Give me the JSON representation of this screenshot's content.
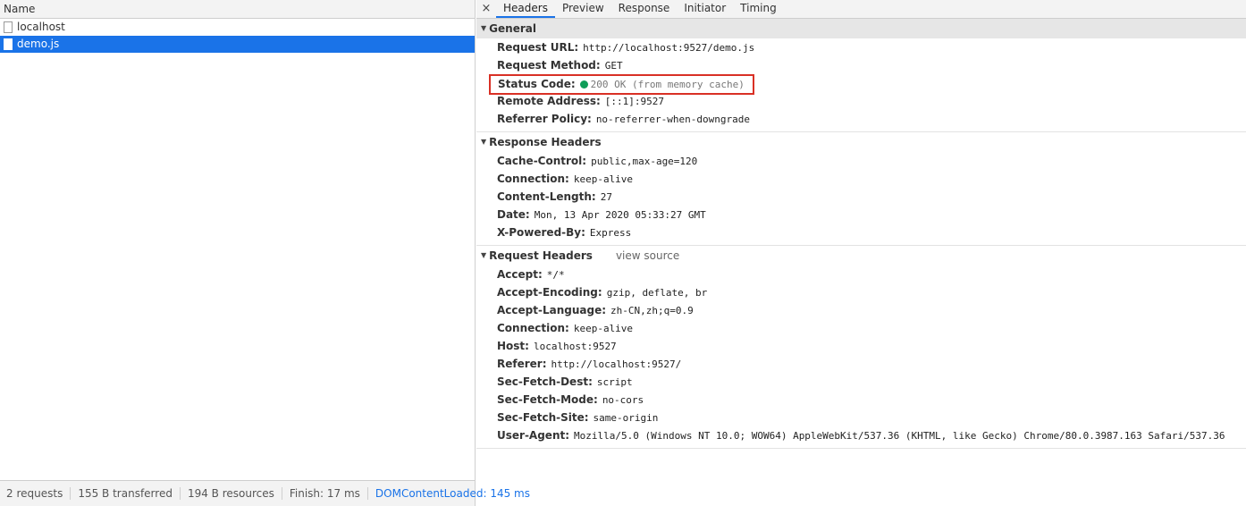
{
  "left": {
    "name_header": "Name",
    "requests": [
      {
        "name": "localhost"
      },
      {
        "name": "demo.js"
      }
    ],
    "status_bar": {
      "requests": "2 requests",
      "transferred": "155 B transferred",
      "resources": "194 B resources",
      "finish": "Finish: 17 ms",
      "dom_content_loaded": "DOMContentLoaded: 145 ms"
    }
  },
  "right": {
    "close_symbol": "×",
    "tabs": [
      {
        "label": "Headers"
      },
      {
        "label": "Preview"
      },
      {
        "label": "Response"
      },
      {
        "label": "Initiator"
      },
      {
        "label": "Timing"
      }
    ],
    "general": {
      "title": "General",
      "rows": [
        {
          "key": "Request URL:",
          "value": "http://localhost:9527/demo.js"
        },
        {
          "key": "Request Method:",
          "value": "GET"
        },
        {
          "key": "Status Code:",
          "value": "200 OK (from memory cache)"
        },
        {
          "key": "Remote Address:",
          "value": "[::1]:9527"
        },
        {
          "key": "Referrer Policy:",
          "value": "no-referrer-when-downgrade"
        }
      ]
    },
    "response_headers": {
      "title": "Response Headers",
      "rows": [
        {
          "key": "Cache-Control:",
          "value": "public,max-age=120"
        },
        {
          "key": "Connection:",
          "value": "keep-alive"
        },
        {
          "key": "Content-Length:",
          "value": "27"
        },
        {
          "key": "Date:",
          "value": "Mon, 13 Apr 2020 05:33:27 GMT"
        },
        {
          "key": "X-Powered-By:",
          "value": "Express"
        }
      ]
    },
    "request_headers": {
      "title": "Request Headers",
      "view_source": "view source",
      "rows": [
        {
          "key": "Accept:",
          "value": "*/*"
        },
        {
          "key": "Accept-Encoding:",
          "value": "gzip, deflate, br"
        },
        {
          "key": "Accept-Language:",
          "value": "zh-CN,zh;q=0.9"
        },
        {
          "key": "Connection:",
          "value": "keep-alive"
        },
        {
          "key": "Host:",
          "value": "localhost:9527"
        },
        {
          "key": "Referer:",
          "value": "http://localhost:9527/"
        },
        {
          "key": "Sec-Fetch-Dest:",
          "value": "script"
        },
        {
          "key": "Sec-Fetch-Mode:",
          "value": "no-cors"
        },
        {
          "key": "Sec-Fetch-Site:",
          "value": "same-origin"
        },
        {
          "key": "User-Agent:",
          "value": "Mozilla/5.0 (Windows NT 10.0; WOW64) AppleWebKit/537.36 (KHTML, like Gecko) Chrome/80.0.3987.163 Safari/537.36"
        }
      ]
    }
  },
  "colors": {
    "selection": "#1a73e8",
    "status_ok": "#0f9d58",
    "highlight_box": "#d93025"
  }
}
